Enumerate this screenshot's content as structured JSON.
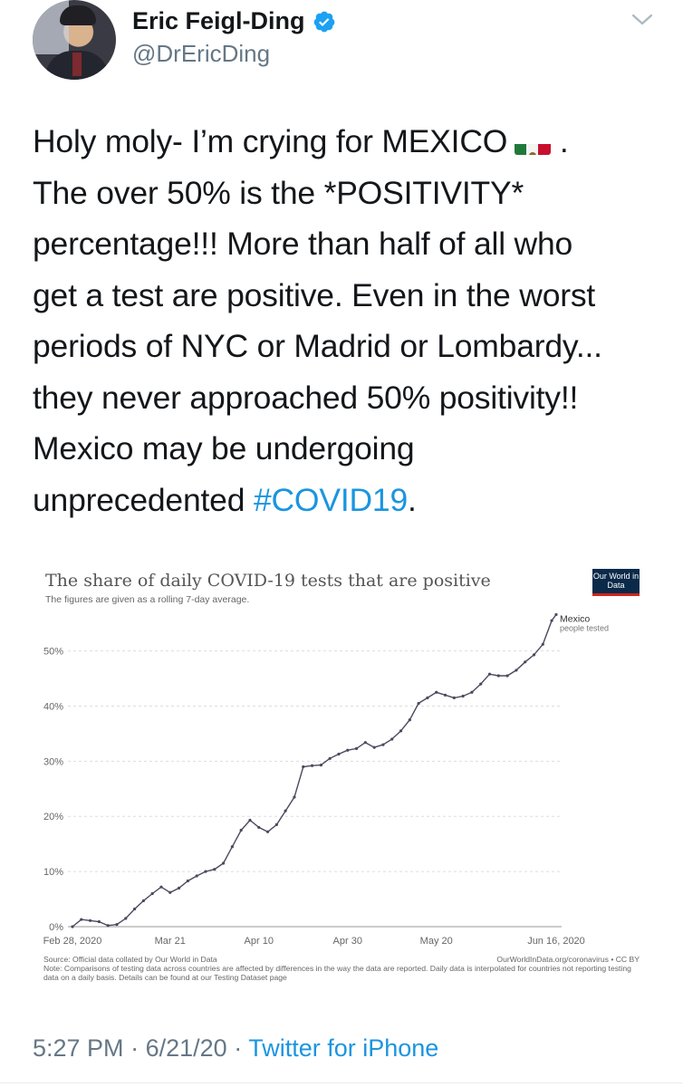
{
  "author": {
    "display_name": "Eric Feigl-Ding",
    "handle": "@DrEricDing",
    "verified": true
  },
  "tweet": {
    "lines": [
      "Holy moly- I’m crying for MEXICO",
      "The over 50% is the *POSITIVITY*",
      "percentage!!! More than half of all who",
      "get a test are positive. Even in the worst",
      "periods of NYC or Madrid or Lombardy...",
      "they never approached 50% positivity!!",
      "Mexico may be undergoing",
      "unprecedented"
    ],
    "line1_suffix": ".",
    "hashtag": "#COVID19",
    "hashtag_suffix": ".",
    "flag_icon": "mexico-flag-emoji"
  },
  "chart": {
    "logo_text": "Our World in Data",
    "source_text": "Source: Official data collated by Our World in Data",
    "url_text": "OurWorldInData.org/coronavirus • CC BY",
    "note_text": "Note: Comparisons of testing data across countries are affected by differences in the way the data are reported. Daily data is interpolated for countries not reporting testing data on a daily basis. Details can be found at our Testing Dataset page"
  },
  "chart_data": {
    "type": "line",
    "title": "The share of daily COVID-19 tests that are positive",
    "subtitle": "The figures are given as a rolling 7-day average.",
    "xlabel": "",
    "ylabel": "",
    "x_tick_labels": [
      "Feb 28, 2020",
      "Mar 21",
      "Apr 10",
      "Apr 30",
      "May 20",
      "Jun 16, 2020"
    ],
    "y_tick_labels": [
      "0%",
      "10%",
      "20%",
      "30%",
      "40%",
      "50%"
    ],
    "ylim": [
      0,
      57
    ],
    "grid": true,
    "series": [
      {
        "name": "Mexico",
        "label_sub": "people tested",
        "color": "#4a4a5e",
        "x": [
          "2020-02-28",
          "2020-03-01",
          "2020-03-03",
          "2020-03-05",
          "2020-03-07",
          "2020-03-09",
          "2020-03-11",
          "2020-03-13",
          "2020-03-15",
          "2020-03-17",
          "2020-03-19",
          "2020-03-21",
          "2020-03-23",
          "2020-03-25",
          "2020-03-27",
          "2020-03-29",
          "2020-03-31",
          "2020-04-02",
          "2020-04-04",
          "2020-04-06",
          "2020-04-08",
          "2020-04-10",
          "2020-04-12",
          "2020-04-14",
          "2020-04-16",
          "2020-04-18",
          "2020-04-20",
          "2020-04-22",
          "2020-04-24",
          "2020-04-26",
          "2020-04-28",
          "2020-04-30",
          "2020-05-02",
          "2020-05-04",
          "2020-05-06",
          "2020-05-08",
          "2020-05-10",
          "2020-05-12",
          "2020-05-14",
          "2020-05-16",
          "2020-05-18",
          "2020-05-20",
          "2020-05-22",
          "2020-05-24",
          "2020-05-26",
          "2020-05-28",
          "2020-05-30",
          "2020-06-01",
          "2020-06-03",
          "2020-06-05",
          "2020-06-07",
          "2020-06-09",
          "2020-06-11",
          "2020-06-13",
          "2020-06-15",
          "2020-06-16"
        ],
        "values": [
          0,
          1.3,
          1.1,
          0.9,
          0.2,
          0.4,
          1.5,
          3.2,
          4.7,
          6,
          7.2,
          6.2,
          7,
          8.3,
          9.2,
          10,
          10.4,
          11.5,
          14.5,
          17.5,
          19.3,
          18,
          17.2,
          18.5,
          21,
          23.5,
          29,
          29.2,
          29.3,
          30.5,
          31.3,
          32,
          32.3,
          33.4,
          32.5,
          33,
          34,
          35.5,
          37.5,
          40.5,
          41.5,
          42.5,
          42,
          41.5,
          41.8,
          42.5,
          44,
          45.8,
          45.5,
          45.5,
          46.5,
          48,
          49.3,
          51.2,
          55.5,
          56.6
        ]
      }
    ]
  },
  "footer": {
    "time": "5:27 PM",
    "separator": "·",
    "date": "6/21/20",
    "source": "Twitter for iPhone"
  },
  "icons": {
    "verified": "verified-badge-icon",
    "caret": "chevron-down-icon"
  },
  "colors": {
    "link": "#1b95e0",
    "secondary": "#657786",
    "line": "#4a4a5e"
  }
}
